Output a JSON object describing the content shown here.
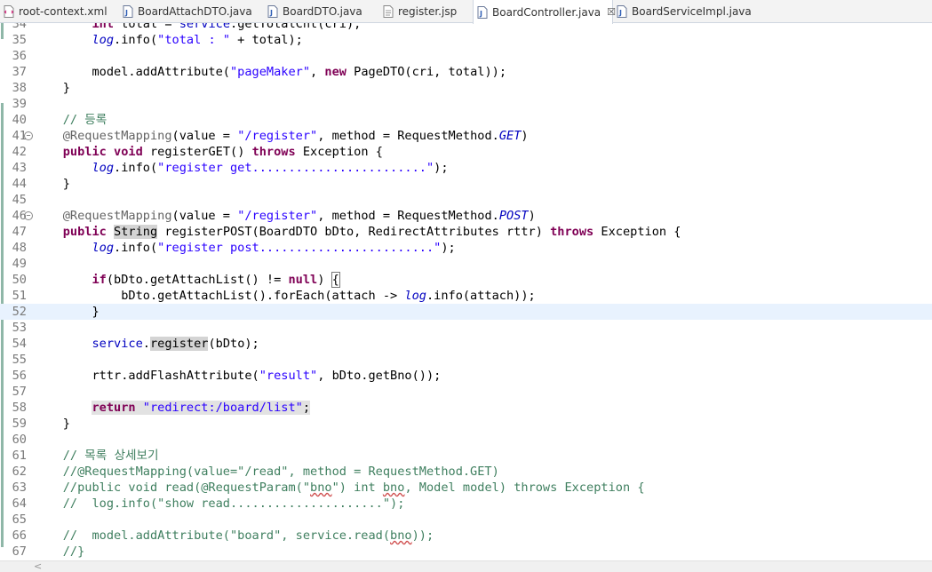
{
  "tabs": [
    {
      "label": "root-context.xml",
      "icon": "xml-file-icon",
      "active": false
    },
    {
      "label": "BoardAttachDTO.java",
      "icon": "java-file-icon",
      "active": false
    },
    {
      "label": "BoardDTO.java",
      "icon": "java-file-icon",
      "active": false
    },
    {
      "label": "register.jsp",
      "icon": "jsp-file-icon",
      "active": false
    },
    {
      "label": "BoardController.java",
      "icon": "java-file-icon",
      "active": true,
      "close": "☒"
    },
    {
      "label": "BoardServiceImpl.java",
      "icon": "java-file-icon",
      "active": false
    }
  ],
  "editor": {
    "current_line": 52,
    "lines": [
      {
        "n": "34",
        "t": [
          [
            "",
            "        "
          ],
          [
            "kw",
            "int"
          ],
          [
            "",
            " total = "
          ],
          [
            "fld",
            "service"
          ],
          [
            "",
            ".getTotalCnt(cri);"
          ]
        ]
      },
      {
        "n": "35",
        "t": [
          [
            "",
            "        "
          ],
          [
            "stat",
            "log"
          ],
          [
            "",
            ".info("
          ],
          [
            "str",
            "\"total : \""
          ],
          [
            "",
            " + total);"
          ]
        ]
      },
      {
        "n": "36",
        "t": []
      },
      {
        "n": "37",
        "t": [
          [
            "",
            "        model.addAttribute("
          ],
          [
            "str",
            "\"pageMaker\""
          ],
          [
            "",
            ", "
          ],
          [
            "kw",
            "new"
          ],
          [
            "",
            " PageDTO(cri, total));"
          ]
        ]
      },
      {
        "n": "38",
        "t": [
          [
            "",
            "    }"
          ]
        ]
      },
      {
        "n": "39",
        "t": []
      },
      {
        "n": "40",
        "t": [
          [
            "",
            "    "
          ],
          [
            "cmt",
            "// 등록"
          ]
        ]
      },
      {
        "n": "41",
        "fold": true,
        "t": [
          [
            "",
            "    "
          ],
          [
            "ann",
            "@RequestMapping"
          ],
          [
            "",
            "(value = "
          ],
          [
            "str",
            "\"/register\""
          ],
          [
            "",
            ", method = RequestMethod."
          ],
          [
            "stat",
            "GET"
          ],
          [
            "",
            ")"
          ]
        ]
      },
      {
        "n": "42",
        "t": [
          [
            "",
            "    "
          ],
          [
            "kw",
            "public"
          ],
          [
            "",
            " "
          ],
          [
            "kw",
            "void"
          ],
          [
            "",
            " registerGET() "
          ],
          [
            "kw",
            "throws"
          ],
          [
            "",
            " Exception {"
          ]
        ]
      },
      {
        "n": "43",
        "t": [
          [
            "",
            "        "
          ],
          [
            "stat",
            "log"
          ],
          [
            "",
            ".info("
          ],
          [
            "str",
            "\"register get........................\""
          ],
          [
            "",
            ");"
          ]
        ]
      },
      {
        "n": "44",
        "t": [
          [
            "",
            "    }"
          ]
        ]
      },
      {
        "n": "45",
        "t": []
      },
      {
        "n": "46",
        "fold": true,
        "t": [
          [
            "",
            "    "
          ],
          [
            "ann",
            "@RequestMapping"
          ],
          [
            "",
            "(value = "
          ],
          [
            "str",
            "\"/register\""
          ],
          [
            "",
            ", method = RequestMethod."
          ],
          [
            "stat",
            "POST"
          ],
          [
            "",
            ")"
          ]
        ]
      },
      {
        "n": "47",
        "t": [
          [
            "",
            "    "
          ],
          [
            "kw",
            "public"
          ],
          [
            "",
            " "
          ],
          [
            "hl",
            "String"
          ],
          [
            "",
            " registerPOST(BoardDTO bDto, RedirectAttributes rttr) "
          ],
          [
            "kw",
            "throws"
          ],
          [
            "",
            " Exception {"
          ]
        ]
      },
      {
        "n": "48",
        "t": [
          [
            "",
            "        "
          ],
          [
            "stat",
            "log"
          ],
          [
            "",
            ".info("
          ],
          [
            "str",
            "\"register post........................\""
          ],
          [
            "",
            ");"
          ]
        ]
      },
      {
        "n": "49",
        "t": []
      },
      {
        "n": "50",
        "t": [
          [
            "",
            "        "
          ],
          [
            "kw",
            "if"
          ],
          [
            "",
            "(bDto.getAttachList() != "
          ],
          [
            "kw",
            "null"
          ],
          [
            "",
            ") "
          ],
          [
            "brkt",
            "{"
          ]
        ]
      },
      {
        "n": "51",
        "t": [
          [
            "",
            "            bDto.getAttachList().forEach(attach -> "
          ],
          [
            "stat",
            "log"
          ],
          [
            "",
            ".info(attach));"
          ]
        ]
      },
      {
        "n": "52",
        "t": [
          [
            "",
            "        }"
          ]
        ]
      },
      {
        "n": "53",
        "t": []
      },
      {
        "n": "54",
        "t": [
          [
            "",
            "        "
          ],
          [
            "fld",
            "service"
          ],
          [
            "",
            "."
          ],
          [
            "hl",
            "register"
          ],
          [
            "",
            "(bDto);"
          ]
        ]
      },
      {
        "n": "55",
        "t": []
      },
      {
        "n": "56",
        "t": [
          [
            "",
            "        rttr.addFlashAttribute("
          ],
          [
            "str",
            "\"result\""
          ],
          [
            "",
            ", bDto.getBno());"
          ]
        ]
      },
      {
        "n": "57",
        "t": []
      },
      {
        "n": "58",
        "t": [
          [
            "",
            "        "
          ],
          [
            "hl2kw",
            "return"
          ],
          [
            "hl2",
            " "
          ],
          [
            "hl2str",
            "\"redirect:/board/list\""
          ],
          [
            "hl2",
            ";"
          ]
        ]
      },
      {
        "n": "59",
        "t": [
          [
            "",
            "    }"
          ]
        ]
      },
      {
        "n": "60",
        "t": []
      },
      {
        "n": "61",
        "t": [
          [
            "",
            "    "
          ],
          [
            "cmt",
            "// 목록 상세보기"
          ]
        ]
      },
      {
        "n": "62",
        "t": [
          [
            "",
            "    "
          ],
          [
            "cmt",
            "//@RequestMapping(value=\"/read\", method = RequestMethod.GET)"
          ]
        ]
      },
      {
        "n": "63",
        "t": [
          [
            "",
            "    "
          ],
          [
            "cmt",
            "//public void read(@RequestParam(\""
          ],
          [
            "cmtsq",
            "bno"
          ],
          [
            "cmt",
            "\") int "
          ],
          [
            "cmtsq",
            "bno"
          ],
          [
            "cmt",
            ", Model model) throws Exception {"
          ]
        ]
      },
      {
        "n": "64",
        "t": [
          [
            "",
            "    "
          ],
          [
            "cmt",
            "//  log.info(\"show read.....................\");"
          ]
        ]
      },
      {
        "n": "65",
        "t": []
      },
      {
        "n": "66",
        "t": [
          [
            "",
            "    "
          ],
          [
            "cmt",
            "//  model.addAttribute(\"board\", service.read("
          ],
          [
            "cmtsq",
            "bno"
          ],
          [
            "cmt",
            "));"
          ]
        ]
      },
      {
        "n": "67",
        "t": [
          [
            "",
            "    "
          ],
          [
            "cmt",
            "//}"
          ]
        ]
      }
    ]
  },
  "scrollbar": {
    "left_arrow": "<"
  }
}
